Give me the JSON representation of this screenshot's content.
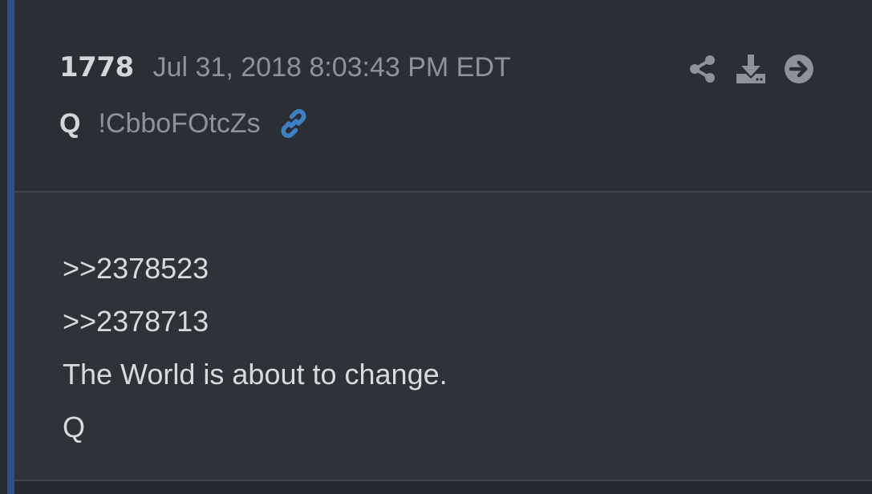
{
  "post": {
    "number": "1778",
    "date": "Jul 31, 2018 8:03:43 PM EDT",
    "author": "Q",
    "tripcode": "!CbboFOtcZs",
    "reply_links": [
      ">>2378523",
      ">>2378713"
    ],
    "message": "The World is about to change.",
    "signature": "Q"
  },
  "icons": {
    "link": "link-icon",
    "share": "share-icon",
    "download": "download-icon",
    "goto": "arrow-right-circle-icon"
  },
  "colors": {
    "accent_bar": "#2f4f86",
    "link_icon": "#3f7fc3",
    "muted_text": "#8e939b",
    "primary_text": "#d4d6da",
    "background": "#2a2e35"
  }
}
